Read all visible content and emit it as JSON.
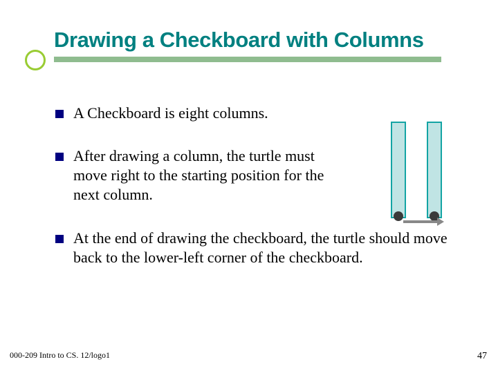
{
  "title": "Drawing a Checkboard with Columns",
  "bullets": {
    "b0": "A Checkboard is eight columns.",
    "b1": "After drawing a column, the turtle must move right to the starting position for the next column.",
    "b2": "At the end of drawing the checkboard, the turtle should move back to the lower-left corner of the checkboard."
  },
  "footer": {
    "left": "000-209 Intro to CS. 12/logo1",
    "page": "47"
  }
}
